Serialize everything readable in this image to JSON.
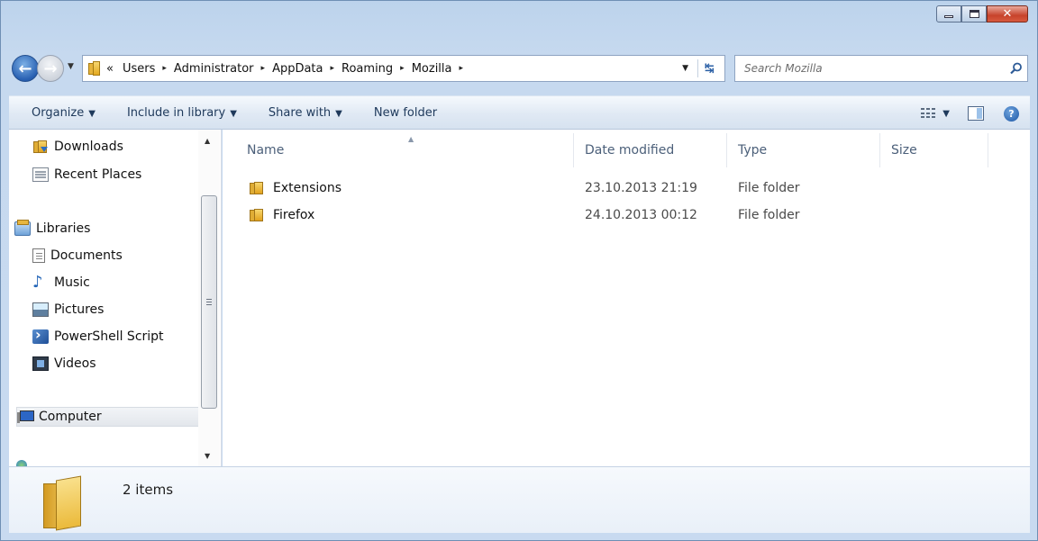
{
  "window": {
    "caption_close": "✕"
  },
  "address_bar": {
    "crumbs": [
      "«",
      "Users",
      "Administrator",
      "AppData",
      "Roaming",
      "Mozilla"
    ],
    "separator": "▸"
  },
  "search": {
    "placeholder": "Search Mozilla"
  },
  "toolbar": {
    "organize": "Organize",
    "include_in_library": "Include in library",
    "share_with": "Share with",
    "new_folder": "New folder"
  },
  "nav_pane": {
    "items": [
      {
        "label": "Downloads",
        "icon": "downloads-folder-icon"
      },
      {
        "label": "Recent Places",
        "icon": "recent-places-icon"
      },
      {
        "label": "Libraries",
        "icon": "libraries-icon"
      },
      {
        "label": "Documents",
        "icon": "documents-icon"
      },
      {
        "label": "Music",
        "icon": "music-icon"
      },
      {
        "label": "Pictures",
        "icon": "pictures-icon"
      },
      {
        "label": "PowerShell Script",
        "icon": "powershell-icon"
      },
      {
        "label": "Videos",
        "icon": "videos-icon"
      },
      {
        "label": "Computer",
        "icon": "computer-icon"
      }
    ]
  },
  "file_list": {
    "columns": [
      "Name",
      "Date modified",
      "Type",
      "Size"
    ],
    "rows": [
      {
        "name": "Extensions",
        "date": "23.10.2013 21:19",
        "type": "File folder",
        "size": ""
      },
      {
        "name": "Firefox",
        "date": "24.10.2013 00:12",
        "type": "File folder",
        "size": ""
      }
    ]
  },
  "details": {
    "count": "2 items"
  },
  "colors": {
    "frame": "#c6d9ef",
    "command_bar_text": "#1e395b",
    "header_text": "#4c607a",
    "folder_yellow": "#e6b43c"
  }
}
